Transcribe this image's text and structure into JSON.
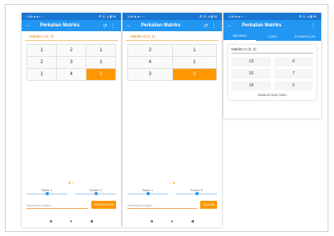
{
  "colors": {
    "appbar": "#2196f3",
    "statusbar": "#1976d2",
    "accent": "#ff9800"
  },
  "status": {
    "left": "1:46 ● ● ▪ ⋯",
    "right": "⚙ ⦿ ⊿ ▮ 85"
  },
  "app_title": "Perkalian Matriks",
  "icons": {
    "back": "back-arrow-icon",
    "history": "history-icon",
    "menu": "more-vert-icon"
  },
  "phone1": {
    "matrix_label": "Matriks A (3, 3)",
    "cells": [
      "1",
      "2",
      "1",
      "2",
      "3",
      "1",
      "1",
      "4",
      "3"
    ],
    "highlight_index": 8,
    "row_label": "Baris 3",
    "col_label": "Kolom 3",
    "row_level": 0.5,
    "col_level": 0.5,
    "input_placeholder": "Masukkan Angka...",
    "button_label": "SELANJUTNYA"
  },
  "phone2": {
    "matrix_label": "Matriks B (3, 2)",
    "cells": [
      "2",
      "1",
      "4",
      "1",
      "3",
      "3"
    ],
    "highlight_index": 5,
    "row_label": "Baris 3",
    "col_label": "Kolom 2",
    "row_level": 0.5,
    "col_level": 0.5,
    "input_placeholder": "Masukkan Angka...",
    "button_label": "SELESAI"
  },
  "phone3": {
    "tabs": [
      "MATRIKS",
      "CARA",
      "KESIMPULAN"
    ],
    "active_tab": 0,
    "result_label": "Matriks C (3, 2)",
    "cells": [
      "13",
      "6",
      "16",
      "7",
      "18",
      "5"
    ],
    "footer": "SEMBUNYIKAN TABEL"
  },
  "nav": {
    "back": "◀",
    "home": "●",
    "recent": "■"
  }
}
